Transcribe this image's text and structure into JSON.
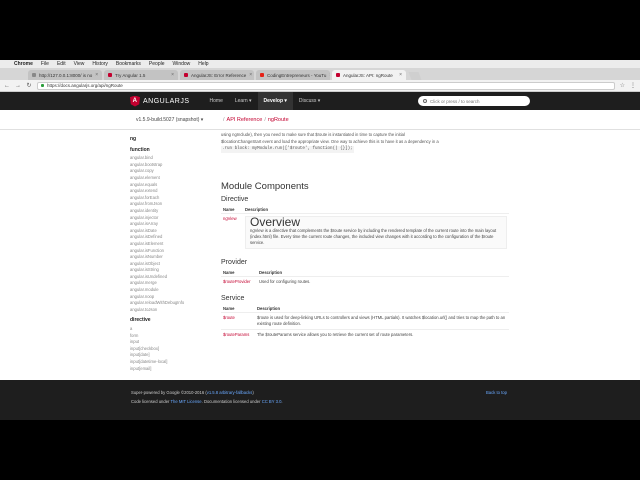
{
  "menubar": {
    "app": "Chrome",
    "items": [
      "File",
      "Edit",
      "View",
      "History",
      "Bookmarks",
      "People",
      "Window",
      "Help"
    ]
  },
  "tabs": [
    {
      "title": "http://127.0.0.1:8000/ is no",
      "active": false
    },
    {
      "title": "Try Angular 1.5",
      "active": false
    },
    {
      "title": "AngularJS: Error Reference",
      "active": false
    },
    {
      "title": "CodingEntrepreneurs - YouTu",
      "active": false
    },
    {
      "title": "AngularJS: API: ngRoute",
      "active": true
    }
  ],
  "toolbar": {
    "back": "←",
    "forward": "→",
    "reload": "↻",
    "url": "https://docs.angularjs.org/api/ngRoute",
    "star": "☆",
    "menu": "⋮"
  },
  "site": {
    "logo_text": "ANGULARJS",
    "nav": [
      {
        "label": "Home",
        "active": false
      },
      {
        "label": "Learn ▾",
        "active": false
      },
      {
        "label": "Develop ▾",
        "active": true
      },
      {
        "label": "Discuss ▾",
        "active": false
      }
    ],
    "search_placeholder": "Click or press / to search"
  },
  "subheader": {
    "version": "v1.5.9-build.5027 (snapshot) ▾",
    "crumbs": [
      "API Reference",
      "ngRoute"
    ]
  },
  "sidebar": {
    "module": "ng",
    "sections": [
      {
        "heading": "function",
        "items": [
          "angular.bind",
          "angular.bootstrap",
          "angular.copy",
          "angular.element",
          "angular.equals",
          "angular.extend",
          "angular.forEach",
          "angular.fromJson",
          "angular.identity",
          "angular.injector",
          "angular.isArray",
          "angular.isDate",
          "angular.isDefined",
          "angular.isElement",
          "angular.isFunction",
          "angular.isNumber",
          "angular.isObject",
          "angular.isString",
          "angular.isUndefined",
          "angular.merge",
          "angular.module",
          "angular.noop",
          "angular.reloadWithDebugInfo",
          "angular.toJson"
        ]
      },
      {
        "heading": "directive",
        "items": [
          "a",
          "form",
          "input",
          "input[checkbox]",
          "input[date]",
          "input[datetime-local]",
          "input[email]"
        ]
      }
    ]
  },
  "content": {
    "intro_1": "using ngInclude), then you need to make sure that $route is instantiated in time to capture the initial",
    "intro_2": "$locationChangeStart event and load the appropriate view. One way to achieve this is to have it as a dependency in a",
    "intro_3": ".run block: myModule.run(['$route', function() {}]);",
    "module_components": "Module Components",
    "directive_heading": "Directive",
    "provider_heading": "Provider",
    "service_heading": "Service",
    "col_name": "Name",
    "col_desc": "Description",
    "directive_row": {
      "name": "ngView",
      "overview_title": "Overview",
      "desc": "ngView is a directive that complements the $route service by including the rendered template of the current route into the main layout (index.html) file. Every time the current route changes, the included view changes with it according to the configuration of the $route service."
    },
    "provider_row": {
      "name": "$routeProvider",
      "desc": "Used for configuring routes."
    },
    "service_rows": [
      {
        "name": "$route",
        "desc": "$route is used for deep-linking URLs to controllers and views (HTML partials). It watches $location.url() and tries to map the path to an existing route definition."
      },
      {
        "name": "$routeParams",
        "desc": "The $routeParams service allows you to retrieve the current set of route parameters."
      }
    ]
  },
  "footer": {
    "line1_prefix": "Super-powered by Google ©2010-2016 (",
    "line1_link": "v1.5.8 arbitrary-fallbacks",
    "line1_suffix": ")",
    "line2_prefix": "Code licensed under ",
    "line2_link1": "The MIT License",
    "line2_mid": ". Documentation licensed under ",
    "line2_link2": "CC BY 3.0",
    "line2_suffix": ".",
    "back_to_top": "Back to top"
  }
}
